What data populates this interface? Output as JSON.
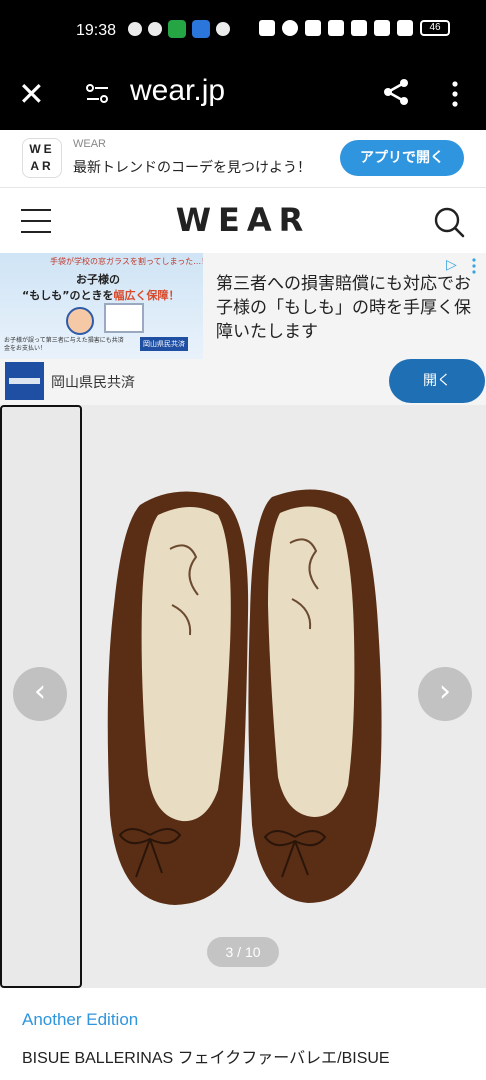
{
  "status_bar": {
    "time": "19:38",
    "battery": "46"
  },
  "browser": {
    "url": "wear.jp"
  },
  "app_banner": {
    "logo_line1": "WE",
    "logo_line2": "AR",
    "brand": "WEAR",
    "tagline": "最新トレンドのコーデを見つけよう！",
    "open_label": "アプリで開く"
  },
  "header": {
    "logo": "WEAR"
  },
  "ad": {
    "image_line1": "手袋が学校の窓ガラスを割ってしまった…！",
    "image_line2": "お子様の",
    "image_line3_a": "“もしも”のときを",
    "image_line3_b": "幅広く保障！",
    "image_fine_print": "お子様が誤って第三者に与えた損害にも共済金をお支払い！",
    "image_sponsor_badge": "岡山県民共済",
    "text": "第三者への損害賠償にも対応でお子様の「もしも」の時を手厚く保障いたします",
    "sponsor": "岡山県民共済",
    "open_label": "開く"
  },
  "carousel": {
    "counter": "3 / 10",
    "prev_glyph": "‹",
    "next_glyph": "›"
  },
  "product": {
    "brand": "Another Edition",
    "name": "BISUE BALLERINAS フェイクファーバレエ/BISUE"
  },
  "colors": {
    "accent": "#2e95de",
    "ad_button": "#1f6fb5",
    "shoe_fur": "#5a2e14",
    "shoe_insole": "#e8dcc2"
  }
}
